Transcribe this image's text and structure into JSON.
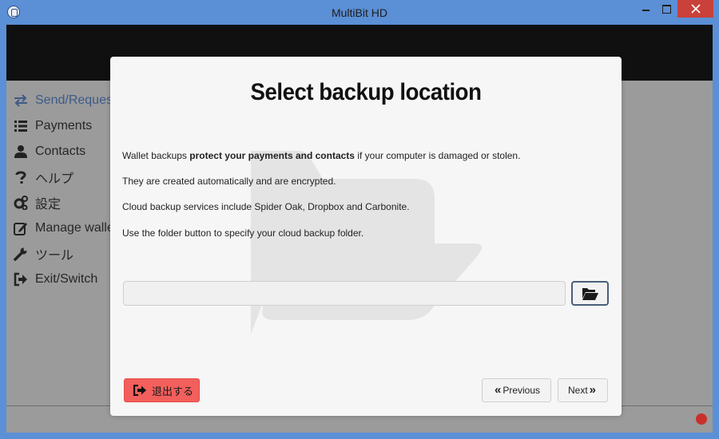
{
  "window": {
    "title": "MultiBit HD"
  },
  "sidebar": {
    "items": [
      {
        "label": "Send/Request",
        "icon": "exchange-icon",
        "active": true
      },
      {
        "label": "Payments",
        "icon": "list-icon"
      },
      {
        "label": "Contacts",
        "icon": "user-icon"
      },
      {
        "label": "ヘルプ",
        "icon": "question-icon"
      },
      {
        "label": "設定",
        "icon": "gears-icon"
      },
      {
        "label": "Manage wallet",
        "icon": "edit-icon"
      },
      {
        "label": "ツール",
        "icon": "wrench-icon"
      },
      {
        "label": "Exit/Switch",
        "icon": "sign-out-icon"
      }
    ]
  },
  "modal": {
    "title": "Select backup location",
    "para1_prefix": "Wallet backups ",
    "para1_bold": "protect your payments and contacts",
    "para1_suffix": " if your computer is damaged or stolen.",
    "para2": "They are created automatically and are encrypted.",
    "para3": "Cloud backup services include Spider Oak, Dropbox and Carbonite.",
    "para4": "Use the folder button to specify your cloud backup folder.",
    "path_value": "",
    "exit_label": "退出する",
    "previous_label": "Previous",
    "next_label": "Next"
  },
  "colors": {
    "exit_button": "#f25f5c",
    "status_dot": "#c9302c",
    "active_nav": "#3d5a88",
    "titlebar": "#5b8fd6"
  }
}
